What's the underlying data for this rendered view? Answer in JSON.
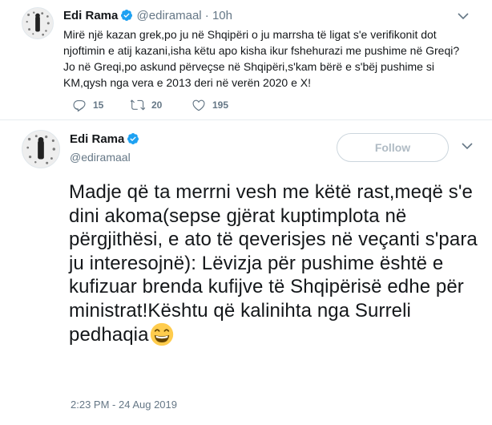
{
  "tweet1": {
    "name": "Edi Rama",
    "handle": "@ediramaal",
    "separator": "·",
    "time": "10h",
    "lines": [
      "Mirë një kazan grek,po ju në Shqipëri o ju marrsha të ligat s'e verifikonit dot",
      "njoftimin e atij kazani,isha këtu apo kisha ikur fshehurazi me pushime në Greqi?",
      "Jo në Greqi,po askund përveçse në Shqipëri,s'kam bërë e s'bëj pushime si",
      "KM,qysh nga vera e 2013 deri në verën 2020 e X!"
    ],
    "reply_count": "15",
    "retweet_count": "20",
    "like_count": "195"
  },
  "tweet2": {
    "name": "Edi Rama",
    "handle": "@ediramaal",
    "follow_label": "Follow",
    "text": "Madje që ta merrni vesh me këtë rast,meqë s'e dini akoma(sepse gjërat kuptimplota në përgjithësi, e ato të qeverisjes në veçanti s'para ju interesojnë): Lëvizja për pushime është e kufizuar brenda kufijve të Shqipërisë edhe për ministrat!Kështu që kalinihta nga Surreli pedhaqia",
    "emoji": "grinning-face-with-smiling-eyes",
    "date": "2:23 PM - 24 Aug 2019"
  },
  "colors": {
    "verified": "#1da1f2",
    "secondary_text": "#657786",
    "divider": "#e6ecf0"
  },
  "icons": [
    "verified-badge-icon",
    "chevron-down-icon",
    "reply-icon",
    "retweet-icon",
    "like-icon"
  ]
}
